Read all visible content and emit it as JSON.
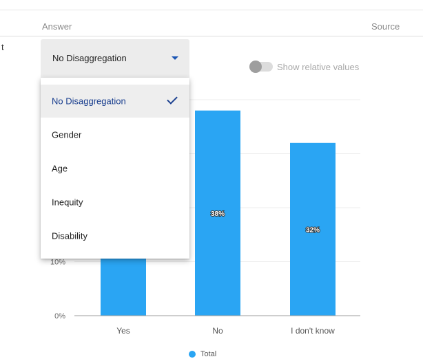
{
  "header": {
    "answer_label": "Answer",
    "source_label": "Source",
    "stray_text": "t"
  },
  "dropdown": {
    "selected": "No Disaggregation",
    "options": [
      "No Disaggregation",
      "Gender",
      "Age",
      "Inequity",
      "Disability"
    ]
  },
  "toggle": {
    "label": "Show relative values",
    "on": false
  },
  "colors": {
    "bar": "#2aa5f3",
    "selected_text": "#1a3f8f",
    "arrow": "#1a55b3"
  },
  "chart_data": {
    "type": "bar",
    "categories": [
      "Yes",
      "No",
      "I don't know"
    ],
    "series": [
      {
        "name": "Total",
        "values": [
          null,
          38,
          32
        ]
      }
    ],
    "data_labels": [
      "",
      "38%",
      "32%"
    ],
    "yticks": [
      "0%",
      "10%"
    ],
    "ylim": [
      0,
      40
    ],
    "grid": true,
    "legend": "bottom-center"
  }
}
